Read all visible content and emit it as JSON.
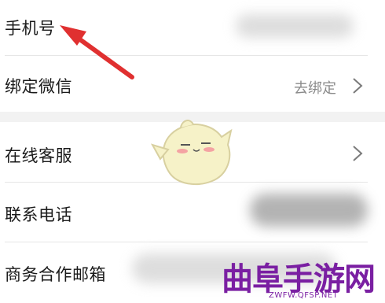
{
  "rows": [
    {
      "label": "手机号"
    },
    {
      "label": "绑定微信",
      "value": "去绑定"
    },
    {
      "label": "在线客服"
    },
    {
      "label": "联系电话"
    },
    {
      "label": "商务合作邮箱"
    }
  ],
  "watermark": {
    "cn": "曲阜手游网",
    "en": "ZWFW.QFSP.NET"
  },
  "icons": {
    "chevron": "chevron-right-icon",
    "annotation": "red-arrow-icon",
    "mascot": "mascot-icon"
  },
  "colors": {
    "background": "#f2f2f2",
    "row": "#ffffff",
    "label": "#1a1a1a",
    "value": "#8a8a8a",
    "arrow": "#e03030",
    "watermark": "#7a1fa2"
  }
}
